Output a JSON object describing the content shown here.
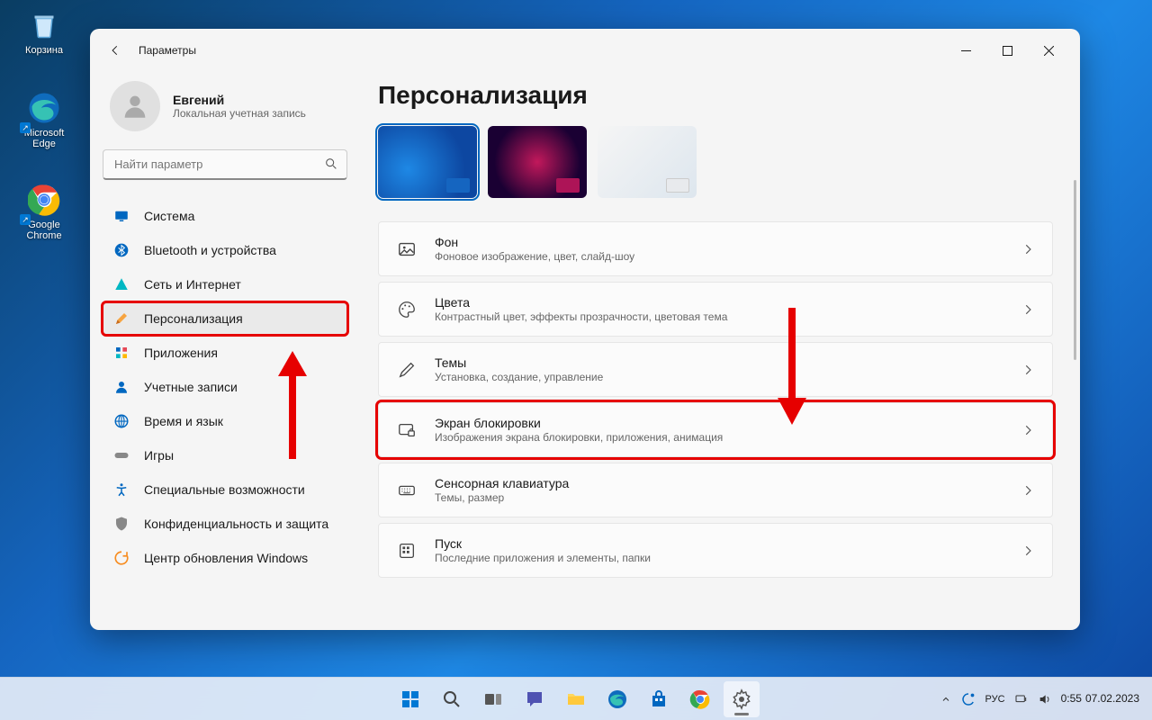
{
  "desktop": {
    "items": [
      {
        "label": "Корзина"
      },
      {
        "label": "Microsoft Edge"
      },
      {
        "label": "Google Chrome"
      }
    ]
  },
  "window": {
    "title": "Параметры",
    "user": {
      "name": "Евгений",
      "sub": "Локальная учетная запись"
    },
    "search_placeholder": "Найти параметр",
    "nav": [
      {
        "label": "Система"
      },
      {
        "label": "Bluetooth и устройства"
      },
      {
        "label": "Сеть и Интернет"
      },
      {
        "label": "Персонализация"
      },
      {
        "label": "Приложения"
      },
      {
        "label": "Учетные записи"
      },
      {
        "label": "Время и язык"
      },
      {
        "label": "Игры"
      },
      {
        "label": "Специальные возможности"
      },
      {
        "label": "Конфиденциальность и защита"
      },
      {
        "label": "Центр обновления Windows"
      }
    ],
    "heading": "Персонализация",
    "cards": [
      {
        "title": "Фон",
        "sub": "Фоновое изображение, цвет, слайд-шоу"
      },
      {
        "title": "Цвета",
        "sub": "Контрастный цвет, эффекты прозрачности, цветовая тема"
      },
      {
        "title": "Темы",
        "sub": "Установка, создание, управление"
      },
      {
        "title": "Экран блокировки",
        "sub": "Изображения экрана блокировки, приложения, анимация"
      },
      {
        "title": "Сенсорная клавиатура",
        "sub": "Темы, размер"
      },
      {
        "title": "Пуск",
        "sub": "Последние приложения и элементы, папки"
      }
    ]
  },
  "tray": {
    "lang": "РУС",
    "time": "0:55",
    "date": "07.02.2023"
  }
}
